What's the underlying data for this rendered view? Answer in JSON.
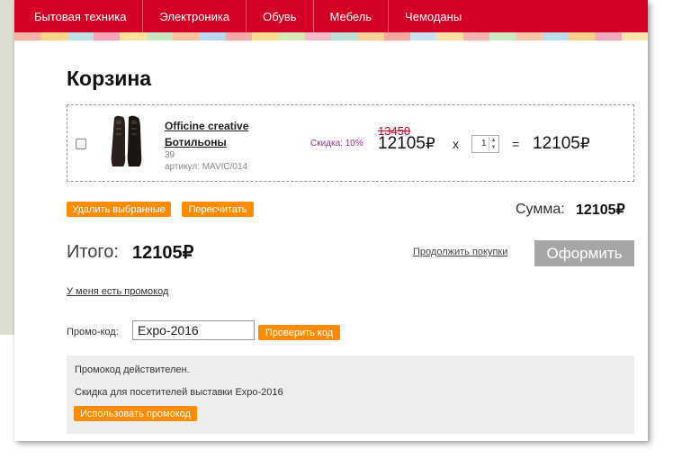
{
  "nav": {
    "items": [
      "Бытовая техника",
      "Электроника",
      "Обувь",
      "Мебель",
      "Чемоданы"
    ]
  },
  "stripes": [
    "#f6b3a3",
    "#f8d58a",
    "#bfe2e6",
    "#f3a6b6",
    "#f7e39b",
    "#c8e5c4",
    "#f9c1a0",
    "#b9d9ef",
    "#f6a9a9",
    "#f7dd8e",
    "#d8e8b6",
    "#f5b8c9",
    "#bde0d8",
    "#f9cf9a",
    "#f2a7a0",
    "#c9e1ef",
    "#f8e0a2",
    "#f4b1b1",
    "#cde7c2",
    "#f7c6a8",
    "#b8dcea",
    "#f6d08a",
    "#f1a9bd",
    "#f8e6ae"
  ],
  "page": {
    "title": "Корзина"
  },
  "cart": {
    "product_name": "Officine creative Ботильоны",
    "size": "39",
    "sku": "артикул: MAVIC/014",
    "discount": "Скидка: 10%",
    "old_price": "13450",
    "price": "12105",
    "times": "x",
    "quantity": "1",
    "equals": "=",
    "line_total": "12105",
    "currency": "₽"
  },
  "actions": {
    "delete_selected": "Удалить выбранные",
    "recalculate": "Пересчитать"
  },
  "summary": {
    "sum_label": "Сумма:",
    "sum_value": "12105",
    "total_label": "Итого:",
    "total_value": "12105",
    "continue_shopping": "Продолжить покупки",
    "checkout": "Оформить"
  },
  "promo": {
    "have_code_link": "У меня есть промокод",
    "label": "Промо-код:",
    "value": "Expo-2016",
    "check_button": "Проверить код",
    "valid_message": "Промокод действителен.",
    "description": "Скидка для посетителей выставки Expo-2016",
    "use_button": "Использовать промокод"
  },
  "colors": {
    "nav_bg": "#d40026",
    "button_orange": "#ff8c00",
    "checkout_gray": "#a6a6a6",
    "old_price_red": "#d40026",
    "discount_purple": "#a0308a"
  }
}
